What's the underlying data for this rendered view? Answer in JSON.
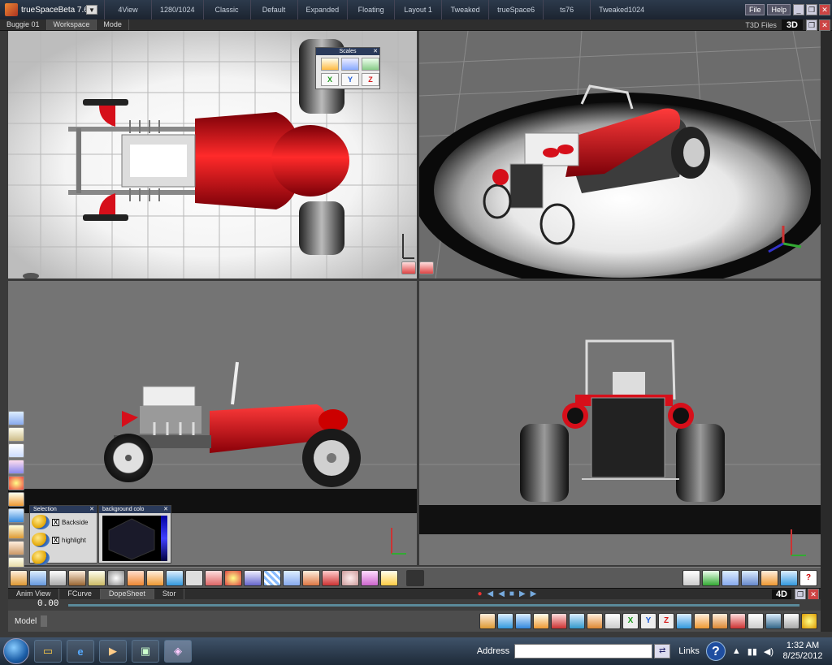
{
  "titlebar": {
    "app_title": "trueSpaceBeta 7.61",
    "contexts": [
      "4View",
      "1280/1024",
      "Classic",
      "Default",
      "Expanded",
      "Floating",
      "Layout 1",
      "Tweaked",
      "trueSpace6",
      "ts76",
      "Tweaked1024"
    ],
    "file_btn": "File",
    "help_btn": "Help"
  },
  "viewport_header": {
    "object_name": "Buggie 01",
    "tabs": [
      "Workspace",
      "Mode"
    ],
    "t3d_files": "T3D Files",
    "label_3d": "3D"
  },
  "axes_panel": {
    "title": "Scales",
    "letters": [
      "X",
      "Y",
      "Z"
    ]
  },
  "selection_panel": {
    "title": "Selection",
    "backside": "Backside",
    "highlight": "highlight",
    "backside_checked": "X",
    "highlight_checked": "X"
  },
  "background_panel": {
    "title": "background colo"
  },
  "anim_bar": {
    "tabs": [
      "Anim View",
      "FCurve",
      "DopeSheet",
      "Stor"
    ],
    "label_4d": "4D"
  },
  "timeline": {
    "frame": "0.00"
  },
  "model_bar": {
    "label": "Model"
  },
  "taskbar": {
    "address_label": "Address",
    "links": "Links",
    "time": "1:32 AM",
    "date": "8/25/2012"
  },
  "colors": {
    "car_red": "#d60f1a",
    "accent_blue": "#2a3a5a",
    "viewport_gray": "#747474"
  },
  "icons": [
    "start-orb",
    "folder-icon",
    "internet-explorer-icon",
    "media-icon",
    "app-icon",
    "truespace-icon"
  ]
}
